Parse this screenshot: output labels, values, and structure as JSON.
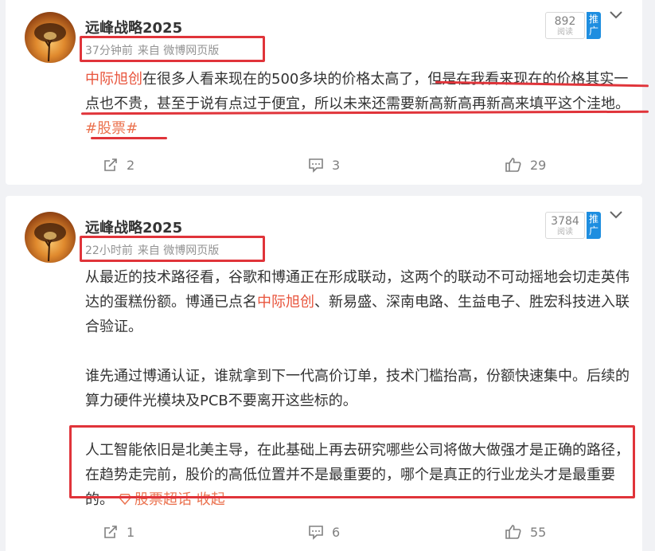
{
  "posts": [
    {
      "username": "远峰战略2025",
      "time": "37分钟前",
      "source": "来自 微博网页版",
      "reads": {
        "count": "892",
        "label": "阅读"
      },
      "promo_label": "推广",
      "body": {
        "mention": "中际旭创",
        "text_a": "在很多人看来现在的500多块的价格太高了，",
        "text_b": "但是在我看来现在的价格其实一点也不贵，甚至于说有点过于便宜，所以未来还需要新高新高再新高来填平这个洼地。",
        "topic": "#股票#"
      },
      "actions": {
        "repost": "2",
        "comment": "3",
        "like": "29"
      }
    },
    {
      "username": "远峰战略2025",
      "time": "22小时前",
      "source": "来自 微博网页版",
      "reads": {
        "count": "3784",
        "label": "阅读"
      },
      "promo_label": "推广",
      "body": {
        "p1_a": "从最近的技术路径看，谷歌和博通正在形成联动，这两个的联动不可动摇地会切走英伟达的蛋糕份额。博通已点名",
        "p1_mention": "中际旭创",
        "p1_b": "、新易盛、深南电路、生益电子、胜宏科技进入联合验证。",
        "p2": "谁先通过博通认证，谁就拿到下一代高价订单，技术门槛抬高，份额快速集中。后续的算力硬件光模块及PCB不要离开这些标的。",
        "p3": "人工智能依旧是北美主导，在此基础上再去研究哪些公司将做大做强才是正确的路径，在趋势走完前，股价的高低位置并不是最重要的，哪个是真正的行业龙头才是最重要的。",
        "supertopic": "股票超话",
        "collapse": "收起"
      },
      "actions": {
        "repost": "1",
        "comment": "6",
        "like": "55"
      }
    }
  ]
}
